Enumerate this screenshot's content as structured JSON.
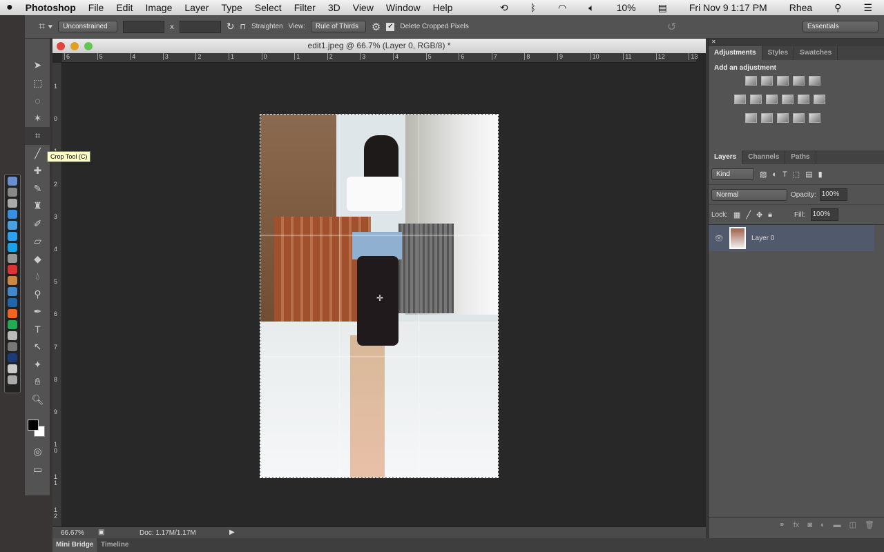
{
  "menubar": {
    "app": "Photoshop",
    "items": [
      "File",
      "Edit",
      "Image",
      "Layer",
      "Type",
      "Select",
      "Filter",
      "3D",
      "View",
      "Window",
      "Help"
    ],
    "battery": "10%",
    "datetime": "Fri Nov 9  1:17 PM",
    "user": "Rhea"
  },
  "options": {
    "ratio": "Unconstrained",
    "x_sep": "x",
    "straighten": "Straighten",
    "view_label": "View:",
    "view_value": "Rule of Thirds",
    "delete_cropped": "Delete Cropped Pixels",
    "delete_checked": true,
    "workspace": "Essentials"
  },
  "tooltip": "Crop Tool (C)",
  "document": {
    "title": "edit1.jpeg @ 66.7% (Layer 0, RGB/8) *",
    "zoom": "66.67%",
    "doc_size": "Doc: 1.17M/1.17M",
    "hruler": [
      "6",
      "5",
      "4",
      "3",
      "2",
      "1",
      "0",
      "1",
      "2",
      "3",
      "4",
      "5",
      "6",
      "7",
      "8",
      "9",
      "10",
      "11",
      "12",
      "13"
    ],
    "vruler": [
      "1",
      "0",
      "1",
      "2",
      "3",
      "4",
      "5",
      "6",
      "7",
      "8",
      "9",
      "10",
      "11",
      "12"
    ]
  },
  "bottom_tabs": [
    "Mini Bridge",
    "Timeline"
  ],
  "adjustments": {
    "tabs": [
      "Adjustments",
      "Styles",
      "Swatches"
    ],
    "heading": "Add an adjustment"
  },
  "layers": {
    "tabs": [
      "Layers",
      "Channels",
      "Paths"
    ],
    "filter": "Kind",
    "blend": "Normal",
    "opacity_label": "Opacity:",
    "opacity": "100%",
    "lock_label": "Lock:",
    "fill_label": "Fill:",
    "fill": "100%",
    "items": [
      {
        "name": "Layer 0",
        "visible": true,
        "selected": true
      }
    ]
  }
}
